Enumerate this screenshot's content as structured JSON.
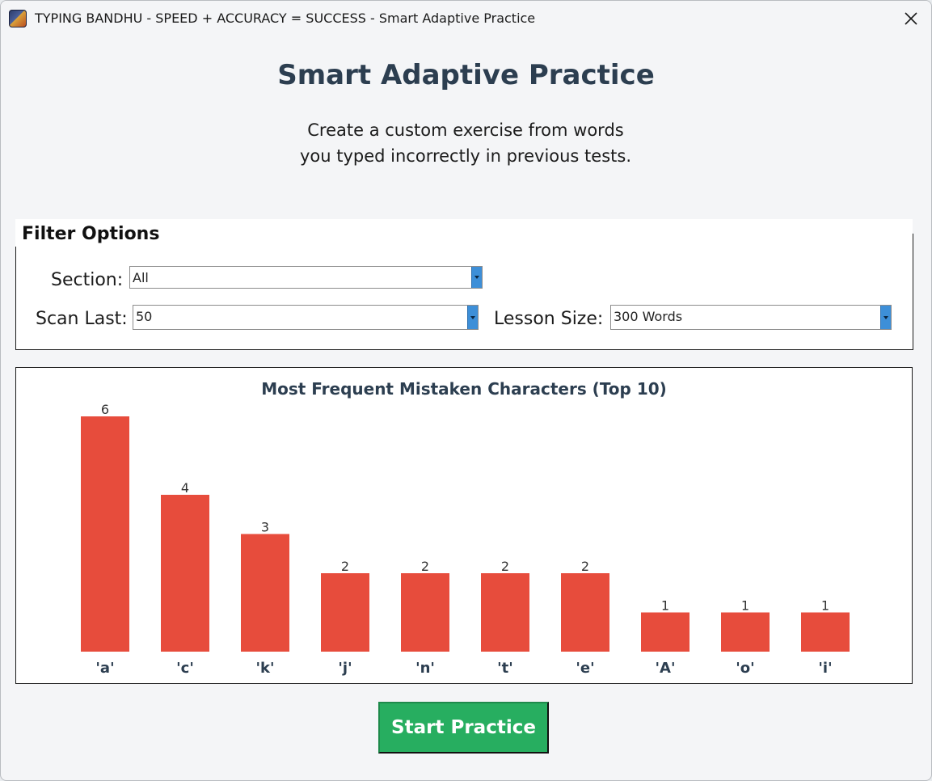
{
  "window": {
    "title": "TYPING BANDHU - SPEED + ACCURACY = SUCCESS - Smart Adaptive Practice"
  },
  "page": {
    "heading": "Smart Adaptive Practice",
    "subtitle": "Create a custom exercise from words you typed incorrectly in previous tests."
  },
  "filters": {
    "legend": "Filter Options",
    "section_label": "Section:",
    "section_value": "All",
    "scan_label": "Scan Last:",
    "scan_value": "50",
    "lesson_label": "Lesson Size:",
    "lesson_value": "300 Words"
  },
  "chart_data": {
    "type": "bar",
    "title": "Most Frequent Mistaken Characters (Top 10)",
    "categories": [
      "'a'",
      "'c'",
      "'k'",
      "'j'",
      "'n'",
      "'t'",
      "'e'",
      "'A'",
      "'o'",
      "'i'"
    ],
    "values": [
      6,
      4,
      3,
      2,
      2,
      2,
      2,
      1,
      1,
      1
    ],
    "ylim": [
      0,
      6
    ],
    "bar_color": "#e74c3c",
    "grid": false,
    "xlabel": "",
    "ylabel": ""
  },
  "actions": {
    "start_label": "Start Practice"
  },
  "colors": {
    "heading": "#2c3e50",
    "start_button": "#27ae60",
    "bar": "#e74c3c"
  }
}
